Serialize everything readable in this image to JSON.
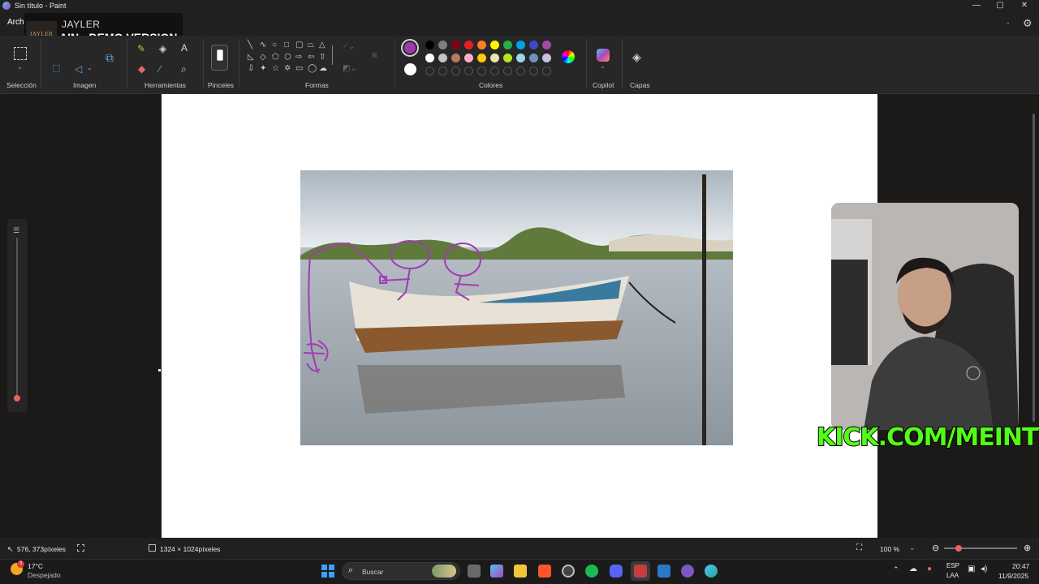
{
  "window": {
    "title": "Sin título - Paint",
    "controls": {
      "minimize": "—",
      "maximize": "▢",
      "close": "✕"
    }
  },
  "menu": {
    "archivo": "Arch"
  },
  "overlay": {
    "logo": "JAYLER",
    "brand": "JAYLER",
    "demo": "AIN - DEMO VERSION"
  },
  "ribbon": {
    "groups": {
      "seleccion": "Selección",
      "imagen": "Imagen",
      "herramientas": "Herramientas",
      "pinceles": "Pinceles",
      "formas": "Formas",
      "colores": "Colores",
      "copilot": "Copilot",
      "capas": "Capas"
    },
    "tool_text_glyph": "A",
    "current_color": "#9b3aa8",
    "secondary_color": "#ffffff",
    "palette_row1": [
      "#000000",
      "#7f7f7f",
      "#880015",
      "#ed1c24",
      "#ff7f27",
      "#fff200",
      "#22b14c",
      "#00a2e8",
      "#3f48cc",
      "#a349a4"
    ],
    "palette_row2": [
      "#ffffff",
      "#c3c3c3",
      "#b97a57",
      "#ffaec9",
      "#ffc90e",
      "#efe4b0",
      "#b5e61d",
      "#99d9ea",
      "#7092be",
      "#c8bfe7"
    ]
  },
  "status": {
    "cursor_position": "576, 373píxeles",
    "canvas_size": "1324 × 1024píxeles",
    "zoom": "100 %"
  },
  "stream": {
    "kick": "KICK.COM/MEINTV"
  },
  "taskbar": {
    "weather_temp": "17°C",
    "weather_desc": "Despejado",
    "weather_badge": "3",
    "search_placeholder": "Buscar",
    "lang": "ESP",
    "lang_sub": "LAA",
    "time": "20:47",
    "date": "11/9/2025"
  }
}
